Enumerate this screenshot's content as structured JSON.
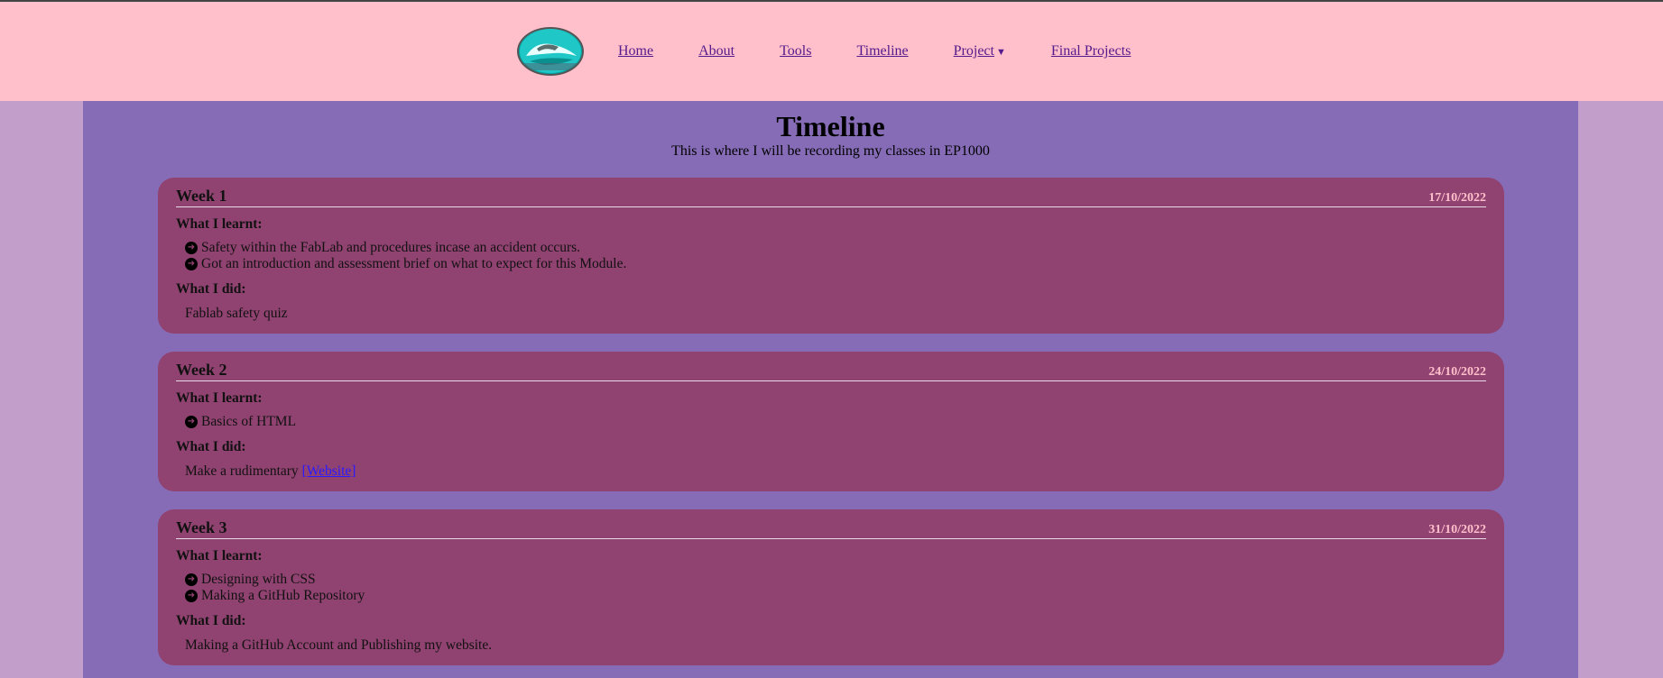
{
  "nav": {
    "items": [
      {
        "label": "Home"
      },
      {
        "label": "About"
      },
      {
        "label": "Tools"
      },
      {
        "label": "Timeline"
      },
      {
        "label": "Project"
      },
      {
        "label": "Final Projects"
      }
    ],
    "dropdown_icon": "caret-down-icon"
  },
  "header": {
    "title": "Timeline",
    "subtitle": "This is where I will be recording my classes in EP1000"
  },
  "weeks": [
    {
      "title": "Week 1",
      "date": "17/10/2022",
      "learnt_heading": "What I learnt:",
      "learnt": [
        "Safety within the FabLab and procedures incase an accident occurs.",
        "Got an introduction and assessment brief on what to expect for this Module."
      ],
      "did_heading": "What I did:",
      "did": "Fablab safety quiz"
    },
    {
      "title": "Week 2",
      "date": "24/10/2022",
      "learnt_heading": "What I learnt:",
      "learnt": [
        "Basics of HTML"
      ],
      "did_heading": "What I did:",
      "did": "Make a rudimentary",
      "did_link": "[Website]"
    },
    {
      "title": "Week 3",
      "date": "31/10/2022",
      "learnt_heading": "What I learnt:",
      "learnt": [
        "Designing with CSS",
        "Making a GitHub Repository"
      ],
      "did_heading": "What I did:",
      "did": "Making a GitHub Account and Publishing my website."
    }
  ],
  "colors": {
    "navbar": "#ffc0cb",
    "page_background": "#c29fcb",
    "main_panel": "#866cb6",
    "card": "#904270",
    "date_text": "#ffc0cb",
    "link": "#551a8b"
  }
}
